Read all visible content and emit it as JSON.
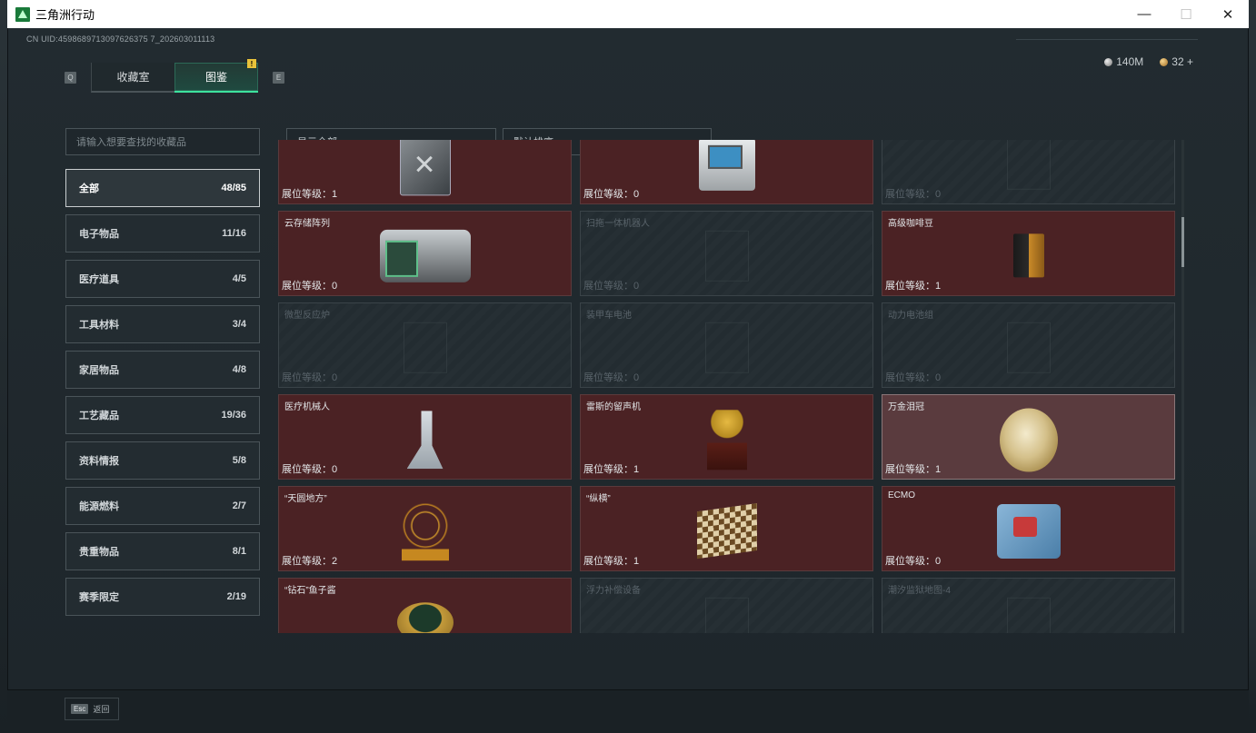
{
  "window": {
    "title": "三角洲行动",
    "controls": [
      "minimize",
      "maximize",
      "close"
    ]
  },
  "header": {
    "uid": "CN UID:4598689713097626375 7_202603011113",
    "tabs": [
      {
        "label": "收藏室",
        "active": false
      },
      {
        "label": "图鉴",
        "active": true,
        "badge": "!"
      }
    ],
    "key_left": "Q",
    "key_right": "E",
    "currency": [
      {
        "icon": "silver-coin-icon",
        "value": "140M"
      },
      {
        "icon": "gold-coin-icon",
        "value": "32"
      }
    ],
    "add_label": "+"
  },
  "sidebar": {
    "search_placeholder": "请输入想要查找的收藏品",
    "categories": [
      {
        "label": "全部",
        "count": "48/85",
        "active": true
      },
      {
        "label": "电子物品",
        "count": "11/16"
      },
      {
        "label": "医疗道具",
        "count": "4/5"
      },
      {
        "label": "工具材料",
        "count": "3/4"
      },
      {
        "label": "家居物品",
        "count": "4/8"
      },
      {
        "label": "工艺藏品",
        "count": "19/36"
      },
      {
        "label": "资料情报",
        "count": "5/8"
      },
      {
        "label": "能源燃料",
        "count": "2/7"
      },
      {
        "label": "贵重物品",
        "count": "8/1"
      },
      {
        "label": "赛季限定",
        "count": "2/19"
      }
    ]
  },
  "filters": {
    "show": "显示全部",
    "sort": "默认排序"
  },
  "level_prefix": "展位等级：",
  "grid": [
    {
      "name": "",
      "level": "1",
      "owned": true,
      "art": "jerry-can-icon"
    },
    {
      "name": "",
      "level": "0",
      "owned": true,
      "art": "terminal-icon"
    },
    {
      "name": "",
      "level": "0",
      "owned": false,
      "art": "ghost-icon"
    },
    {
      "name": "云存储阵列",
      "level": "0",
      "owned": true,
      "art": "server-array-icon"
    },
    {
      "name": "扫拖一体机器人",
      "level": "0",
      "owned": false,
      "art": "ghost-icon"
    },
    {
      "name": "高级咖啡豆",
      "level": "1",
      "owned": true,
      "art": "coffee-bag-icon"
    },
    {
      "name": "微型反应炉",
      "level": "0",
      "owned": false,
      "art": "ghost-icon"
    },
    {
      "name": "装甲车电池",
      "level": "0",
      "owned": false,
      "art": "ghost-icon"
    },
    {
      "name": "动力电池组",
      "level": "0",
      "owned": false,
      "art": "ghost-icon"
    },
    {
      "name": "医疗机械人",
      "level": "0",
      "owned": true,
      "art": "medical-robot-icon"
    },
    {
      "name": "雷斯的留声机",
      "level": "1",
      "owned": true,
      "art": "phonograph-icon"
    },
    {
      "name": "万金泪冠",
      "level": "1",
      "owned": true,
      "selected": true,
      "art": "jeweled-egg-icon"
    },
    {
      "name": "“天圆地方”",
      "level": "2",
      "owned": true,
      "art": "armillary-icon"
    },
    {
      "name": "“纵横”",
      "level": "1",
      "owned": true,
      "art": "chessboard-icon"
    },
    {
      "name": "ECMO",
      "level": "0",
      "owned": true,
      "art": "ecmo-icon"
    },
    {
      "name": "“钻石”鱼子酱",
      "level": "",
      "owned": true,
      "art": "caviar-icon"
    },
    {
      "name": "浮力补偿设备",
      "level": "",
      "owned": false,
      "art": "ghost-icon"
    },
    {
      "name": "潮汐监狱地图-4",
      "level": "",
      "owned": false,
      "art": "ghost-icon"
    }
  ],
  "footer": {
    "esc_key": "Esc",
    "back_label": "返回"
  }
}
